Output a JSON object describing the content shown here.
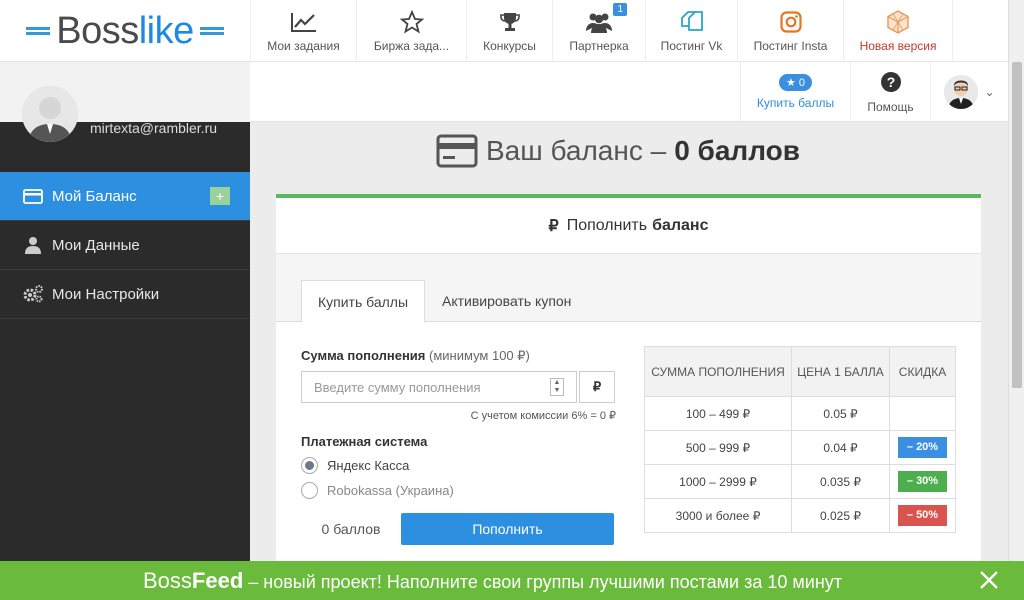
{
  "brand": {
    "part1": "Boss",
    "part2": "like"
  },
  "nav": [
    {
      "label": "Мои задания",
      "icon": "chart-line-icon"
    },
    {
      "label": "Биржа зада...",
      "icon": "star-icon"
    },
    {
      "label": "Конкурсы",
      "icon": "trophy-icon"
    },
    {
      "label": "Партнерка",
      "icon": "users-icon",
      "badge": "1"
    },
    {
      "label": "Постинг Vk",
      "icon": "copy-icon"
    },
    {
      "label": "Постинг Insta",
      "icon": "instagram-icon"
    },
    {
      "label": "Новая версия",
      "icon": "cube-icon"
    }
  ],
  "subbar": {
    "buy_label": "Купить баллы",
    "buy_count": "0",
    "help_label": "Помощь"
  },
  "sidebar": {
    "email": "mirtexta@rambler.ru",
    "items": [
      {
        "label": "Мой Баланс",
        "icon": "card-icon"
      },
      {
        "label": "Мои Данные",
        "icon": "user-icon"
      },
      {
        "label": "Мои Настройки",
        "icon": "gears-icon"
      }
    ]
  },
  "balance": {
    "prefix": "Ваш баланс –",
    "value": "0 баллов"
  },
  "panel": {
    "title_plain": "Пополнить",
    "title_bold": "баланс",
    "tabs": [
      "Купить баллы",
      "Активировать купон"
    ]
  },
  "form": {
    "amount_label": "Сумма пополнения",
    "amount_hint": "(минимум 100 ₽)",
    "placeholder": "Введите сумму пополнения",
    "currency": "₽",
    "commission": "С учетом комиссии 6% = 0 ₽",
    "payment_label": "Платежная система",
    "options": [
      "Яндекс Касса",
      "Robokassa (Украина)"
    ],
    "points": "0 баллов",
    "submit": "Пополнить"
  },
  "price_table": {
    "headers": [
      "СУММА ПОПОЛНЕНИЯ",
      "ЦЕНА 1 БАЛЛА",
      "СКИДКА"
    ],
    "rows": [
      {
        "range": "100 – 499 ₽",
        "price": "0.05 ₽",
        "discount": ""
      },
      {
        "range": "500 – 999 ₽",
        "price": "0.04 ₽",
        "discount": "– 20%"
      },
      {
        "range": "1000 – 2999 ₽",
        "price": "0.035 ₽",
        "discount": "– 30%"
      },
      {
        "range": "3000 и более ₽",
        "price": "0.025 ₽",
        "discount": "– 50%"
      }
    ]
  },
  "banner": {
    "boss": "Boss",
    "feed": "Feed",
    "text": " – новый проект! Наполните свои группы лучшими постами за 10 минут"
  },
  "colors": {
    "accent": "#2d8fe0",
    "green": "#6aba3c",
    "disc20": "#3b8fe0",
    "disc30": "#4cae4c",
    "disc50": "#d9534f"
  }
}
